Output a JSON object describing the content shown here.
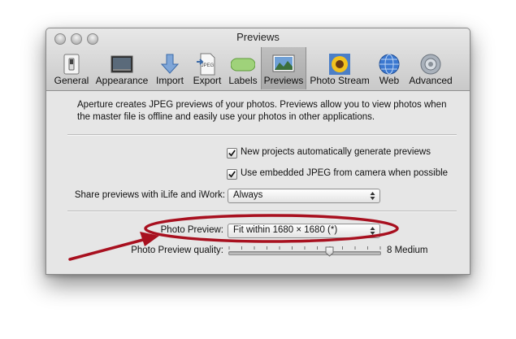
{
  "window": {
    "title": "Previews",
    "toolbar": [
      {
        "id": "general",
        "label": "General",
        "icon": "switch-icon",
        "selected": false
      },
      {
        "id": "appearance",
        "label": "Appearance",
        "icon": "monitor-icon",
        "selected": false
      },
      {
        "id": "import",
        "label": "Import",
        "icon": "import-arrow-icon",
        "selected": false
      },
      {
        "id": "export",
        "label": "Export",
        "icon": "jpeg-document-icon",
        "selected": false
      },
      {
        "id": "labels",
        "label": "Labels",
        "icon": "label-pill-icon",
        "selected": false
      },
      {
        "id": "previews",
        "label": "Previews",
        "icon": "landscape-photo-icon",
        "selected": true
      },
      {
        "id": "photostream",
        "label": "Photo Stream",
        "icon": "sunflower-icon",
        "selected": false
      },
      {
        "id": "web",
        "label": "Web",
        "icon": "globe-icon",
        "selected": false
      },
      {
        "id": "advanced",
        "label": "Advanced",
        "icon": "gear-icon",
        "selected": false
      }
    ]
  },
  "content": {
    "description": "Aperture creates JPEG previews of your photos.  Previews allow you to view photos when the master file is offline and easily use your photos in other applications.",
    "checkbox_auto_generate": {
      "label": "New projects automatically generate previews",
      "checked": true
    },
    "checkbox_embedded_jpeg": {
      "label": "Use embedded JPEG from camera when possible",
      "checked": true
    },
    "share_previews": {
      "label": "Share previews with iLife and iWork:",
      "value": "Always"
    },
    "photo_preview": {
      "label": "Photo Preview:",
      "value": "Fit within 1680 × 1680 (*)"
    },
    "photo_preview_quality": {
      "label": "Photo Preview quality:",
      "value_text": "8 Medium",
      "value": 8,
      "min": 0,
      "max": 12
    }
  },
  "annotation": {
    "color": "#a8101f"
  }
}
